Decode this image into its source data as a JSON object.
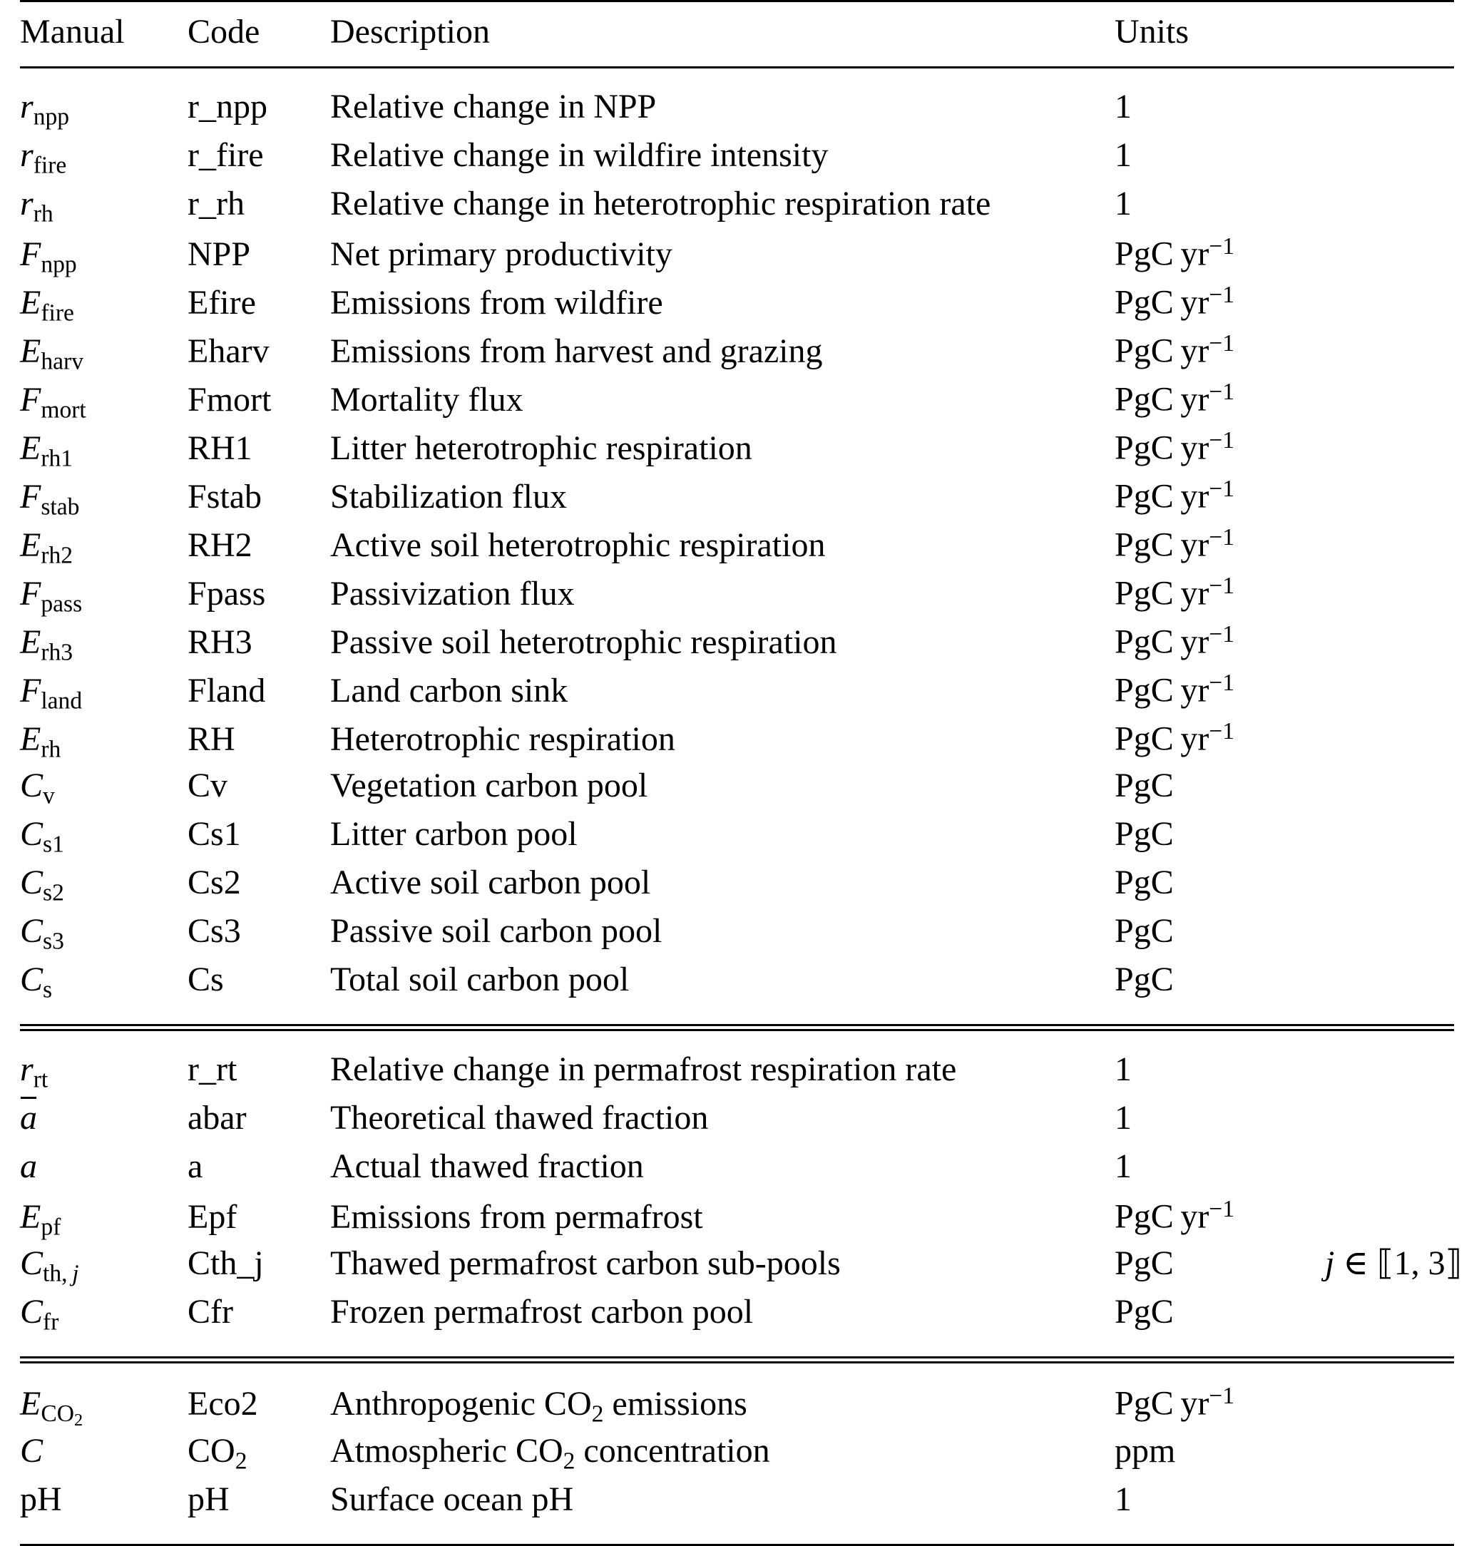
{
  "table": {
    "headers": {
      "manual": "Manual",
      "code": "Code",
      "description": "Description",
      "units": "Units",
      "note": ""
    },
    "units_labels": {
      "dimensionless": "1",
      "flux": "PgC yr−1",
      "pool": "PgC",
      "ppm": "ppm"
    },
    "sections": [
      {
        "id": "land-carbon-cycle",
        "rows": [
          {
            "manual_var": "r",
            "manual_sub": "npp",
            "manual_sub_italic": "",
            "code": "r_npp",
            "description": "Relative change in NPP",
            "units": "1",
            "units_sup": "",
            "note": ""
          },
          {
            "manual_var": "r",
            "manual_sub": "fire",
            "manual_sub_italic": "",
            "code": "r_fire",
            "description": "Relative change in wildfire intensity",
            "units": "1",
            "units_sup": "",
            "note": ""
          },
          {
            "manual_var": "r",
            "manual_sub": "rh",
            "manual_sub_italic": "",
            "code": "r_rh",
            "description": "Relative change in heterotrophic respiration rate",
            "units": "1",
            "units_sup": "",
            "note": ""
          },
          {
            "manual_var": "F",
            "manual_sub": "npp",
            "manual_sub_italic": "",
            "code": "NPP",
            "description": "Net primary productivity",
            "units": "PgC yr",
            "units_sup": "−1",
            "note": ""
          },
          {
            "manual_var": "E",
            "manual_sub": "fire",
            "manual_sub_italic": "",
            "code": "Efire",
            "description": "Emissions from wildfire",
            "units": "PgC yr",
            "units_sup": "−1",
            "note": ""
          },
          {
            "manual_var": "E",
            "manual_sub": "harv",
            "manual_sub_italic": "",
            "code": "Eharv",
            "description": "Emissions from harvest and grazing",
            "units": "PgC yr",
            "units_sup": "−1",
            "note": ""
          },
          {
            "manual_var": "F",
            "manual_sub": "mort",
            "manual_sub_italic": "",
            "code": "Fmort",
            "description": "Mortality flux",
            "units": "PgC yr",
            "units_sup": "−1",
            "note": ""
          },
          {
            "manual_var": "E",
            "manual_sub": "rh1",
            "manual_sub_italic": "",
            "code": "RH1",
            "description": "Litter heterotrophic respiration",
            "units": "PgC yr",
            "units_sup": "−1",
            "note": ""
          },
          {
            "manual_var": "F",
            "manual_sub": "stab",
            "manual_sub_italic": "",
            "code": "Fstab",
            "description": "Stabilization flux",
            "units": "PgC yr",
            "units_sup": "−1",
            "note": ""
          },
          {
            "manual_var": "E",
            "manual_sub": "rh2",
            "manual_sub_italic": "",
            "code": "RH2",
            "description": "Active soil heterotrophic respiration",
            "units": "PgC yr",
            "units_sup": "−1",
            "note": ""
          },
          {
            "manual_var": "F",
            "manual_sub": "pass",
            "manual_sub_italic": "",
            "code": "Fpass",
            "description": "Passivization flux",
            "units": "PgC yr",
            "units_sup": "−1",
            "note": ""
          },
          {
            "manual_var": "E",
            "manual_sub": "rh3",
            "manual_sub_italic": "",
            "code": "RH3",
            "description": "Passive soil heterotrophic respiration",
            "units": "PgC yr",
            "units_sup": "−1",
            "note": ""
          },
          {
            "manual_var": "F",
            "manual_sub": "land",
            "manual_sub_italic": "",
            "code": "Fland",
            "description": "Land carbon sink",
            "units": "PgC yr",
            "units_sup": "−1",
            "note": ""
          },
          {
            "manual_var": "E",
            "manual_sub": "rh",
            "manual_sub_italic": "",
            "code": "RH",
            "description": "Heterotrophic respiration",
            "units": "PgC yr",
            "units_sup": "−1",
            "note": ""
          },
          {
            "manual_var": "C",
            "manual_sub": "v",
            "manual_sub_italic": "",
            "code": "Cv",
            "description": "Vegetation carbon pool",
            "units": "PgC",
            "units_sup": "",
            "note": ""
          },
          {
            "manual_var": "C",
            "manual_sub": "s1",
            "manual_sub_italic": "",
            "code": "Cs1",
            "description": "Litter carbon pool",
            "units": "PgC",
            "units_sup": "",
            "note": ""
          },
          {
            "manual_var": "C",
            "manual_sub": "s2",
            "manual_sub_italic": "",
            "code": "Cs2",
            "description": "Active soil carbon pool",
            "units": "PgC",
            "units_sup": "",
            "note": ""
          },
          {
            "manual_var": "C",
            "manual_sub": "s3",
            "manual_sub_italic": "",
            "code": "Cs3",
            "description": "Passive soil carbon pool",
            "units": "PgC",
            "units_sup": "",
            "note": ""
          },
          {
            "manual_var": "C",
            "manual_sub": "s",
            "manual_sub_italic": "",
            "code": "Cs",
            "description": "Total soil carbon pool",
            "units": "PgC",
            "units_sup": "",
            "note": ""
          }
        ]
      },
      {
        "id": "permafrost",
        "rows": [
          {
            "manual_var": "r",
            "manual_sub": "rt",
            "manual_sub_italic": "",
            "code": "r_rt",
            "description": "Relative change in permafrost respiration rate",
            "units": "1",
            "units_sup": "",
            "note": ""
          },
          {
            "manual_var": "ā",
            "manual_sub": "",
            "manual_sub_italic": "",
            "code": "abar",
            "description": "Theoretical thawed fraction",
            "units": "1",
            "units_sup": "",
            "note": ""
          },
          {
            "manual_var": "a",
            "manual_sub": "",
            "manual_sub_italic": "",
            "code": "a",
            "description": "Actual thawed fraction",
            "units": "1",
            "units_sup": "",
            "note": ""
          },
          {
            "manual_var": "E",
            "manual_sub": "pf",
            "manual_sub_italic": "",
            "code": "Epf",
            "description": "Emissions from permafrost",
            "units": "PgC yr",
            "units_sup": "−1",
            "note": ""
          },
          {
            "manual_var": "C",
            "manual_sub": "th,",
            "manual_sub_italic": "j",
            "code": "Cth_j",
            "description": "Thawed permafrost carbon sub-pools",
            "units": "PgC",
            "units_sup": "",
            "note": "j ∈ ⟦1, 3⟧"
          },
          {
            "manual_var": "C",
            "manual_sub": "fr",
            "manual_sub_italic": "",
            "code": "Cfr",
            "description": "Frozen permafrost carbon pool",
            "units": "PgC",
            "units_sup": "",
            "note": ""
          }
        ]
      },
      {
        "id": "atmosphere-ocean",
        "rows": [
          {
            "manual_var": "E",
            "manual_sub": "CO2",
            "manual_sub_italic": "",
            "code": "Eco2",
            "description": "Anthropogenic CO2 emissions",
            "units": "PgC yr",
            "units_sup": "−1",
            "note": ""
          },
          {
            "manual_var": "C",
            "manual_sub": "",
            "manual_sub_italic": "",
            "code": "CO2",
            "description": "Atmospheric CO2 concentration",
            "units": "ppm",
            "units_sup": "",
            "note": ""
          },
          {
            "manual_var": "pH",
            "manual_sub": "",
            "manual_sub_italic": "",
            "code": "pH",
            "description": "Surface ocean pH",
            "units": "1",
            "units_sup": "",
            "note": ""
          }
        ]
      }
    ],
    "note_symbol": {
      "variable": "j",
      "operator": "∈",
      "interval": "⟦1, 3⟧"
    }
  },
  "style": {
    "text_color": "#000000",
    "background_color": "#ffffff",
    "rule_color": "#000000"
  }
}
